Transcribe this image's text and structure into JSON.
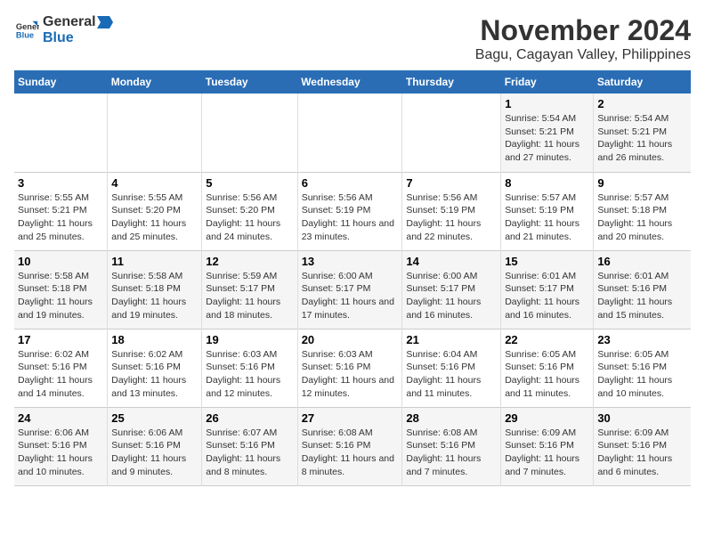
{
  "header": {
    "logo_general": "General",
    "logo_blue": "Blue",
    "title": "November 2024",
    "subtitle": "Bagu, Cagayan Valley, Philippines"
  },
  "columns": [
    "Sunday",
    "Monday",
    "Tuesday",
    "Wednesday",
    "Thursday",
    "Friday",
    "Saturday"
  ],
  "weeks": [
    [
      {
        "day": "",
        "info": ""
      },
      {
        "day": "",
        "info": ""
      },
      {
        "day": "",
        "info": ""
      },
      {
        "day": "",
        "info": ""
      },
      {
        "day": "",
        "info": ""
      },
      {
        "day": "1",
        "info": "Sunrise: 5:54 AM\nSunset: 5:21 PM\nDaylight: 11 hours and 27 minutes."
      },
      {
        "day": "2",
        "info": "Sunrise: 5:54 AM\nSunset: 5:21 PM\nDaylight: 11 hours and 26 minutes."
      }
    ],
    [
      {
        "day": "3",
        "info": "Sunrise: 5:55 AM\nSunset: 5:21 PM\nDaylight: 11 hours and 25 minutes."
      },
      {
        "day": "4",
        "info": "Sunrise: 5:55 AM\nSunset: 5:20 PM\nDaylight: 11 hours and 25 minutes."
      },
      {
        "day": "5",
        "info": "Sunrise: 5:56 AM\nSunset: 5:20 PM\nDaylight: 11 hours and 24 minutes."
      },
      {
        "day": "6",
        "info": "Sunrise: 5:56 AM\nSunset: 5:19 PM\nDaylight: 11 hours and 23 minutes."
      },
      {
        "day": "7",
        "info": "Sunrise: 5:56 AM\nSunset: 5:19 PM\nDaylight: 11 hours and 22 minutes."
      },
      {
        "day": "8",
        "info": "Sunrise: 5:57 AM\nSunset: 5:19 PM\nDaylight: 11 hours and 21 minutes."
      },
      {
        "day": "9",
        "info": "Sunrise: 5:57 AM\nSunset: 5:18 PM\nDaylight: 11 hours and 20 minutes."
      }
    ],
    [
      {
        "day": "10",
        "info": "Sunrise: 5:58 AM\nSunset: 5:18 PM\nDaylight: 11 hours and 19 minutes."
      },
      {
        "day": "11",
        "info": "Sunrise: 5:58 AM\nSunset: 5:18 PM\nDaylight: 11 hours and 19 minutes."
      },
      {
        "day": "12",
        "info": "Sunrise: 5:59 AM\nSunset: 5:17 PM\nDaylight: 11 hours and 18 minutes."
      },
      {
        "day": "13",
        "info": "Sunrise: 6:00 AM\nSunset: 5:17 PM\nDaylight: 11 hours and 17 minutes."
      },
      {
        "day": "14",
        "info": "Sunrise: 6:00 AM\nSunset: 5:17 PM\nDaylight: 11 hours and 16 minutes."
      },
      {
        "day": "15",
        "info": "Sunrise: 6:01 AM\nSunset: 5:17 PM\nDaylight: 11 hours and 16 minutes."
      },
      {
        "day": "16",
        "info": "Sunrise: 6:01 AM\nSunset: 5:16 PM\nDaylight: 11 hours and 15 minutes."
      }
    ],
    [
      {
        "day": "17",
        "info": "Sunrise: 6:02 AM\nSunset: 5:16 PM\nDaylight: 11 hours and 14 minutes."
      },
      {
        "day": "18",
        "info": "Sunrise: 6:02 AM\nSunset: 5:16 PM\nDaylight: 11 hours and 13 minutes."
      },
      {
        "day": "19",
        "info": "Sunrise: 6:03 AM\nSunset: 5:16 PM\nDaylight: 11 hours and 12 minutes."
      },
      {
        "day": "20",
        "info": "Sunrise: 6:03 AM\nSunset: 5:16 PM\nDaylight: 11 hours and 12 minutes."
      },
      {
        "day": "21",
        "info": "Sunrise: 6:04 AM\nSunset: 5:16 PM\nDaylight: 11 hours and 11 minutes."
      },
      {
        "day": "22",
        "info": "Sunrise: 6:05 AM\nSunset: 5:16 PM\nDaylight: 11 hours and 11 minutes."
      },
      {
        "day": "23",
        "info": "Sunrise: 6:05 AM\nSunset: 5:16 PM\nDaylight: 11 hours and 10 minutes."
      }
    ],
    [
      {
        "day": "24",
        "info": "Sunrise: 6:06 AM\nSunset: 5:16 PM\nDaylight: 11 hours and 10 minutes."
      },
      {
        "day": "25",
        "info": "Sunrise: 6:06 AM\nSunset: 5:16 PM\nDaylight: 11 hours and 9 minutes."
      },
      {
        "day": "26",
        "info": "Sunrise: 6:07 AM\nSunset: 5:16 PM\nDaylight: 11 hours and 8 minutes."
      },
      {
        "day": "27",
        "info": "Sunrise: 6:08 AM\nSunset: 5:16 PM\nDaylight: 11 hours and 8 minutes."
      },
      {
        "day": "28",
        "info": "Sunrise: 6:08 AM\nSunset: 5:16 PM\nDaylight: 11 hours and 7 minutes."
      },
      {
        "day": "29",
        "info": "Sunrise: 6:09 AM\nSunset: 5:16 PM\nDaylight: 11 hours and 7 minutes."
      },
      {
        "day": "30",
        "info": "Sunrise: 6:09 AM\nSunset: 5:16 PM\nDaylight: 11 hours and 6 minutes."
      }
    ]
  ]
}
